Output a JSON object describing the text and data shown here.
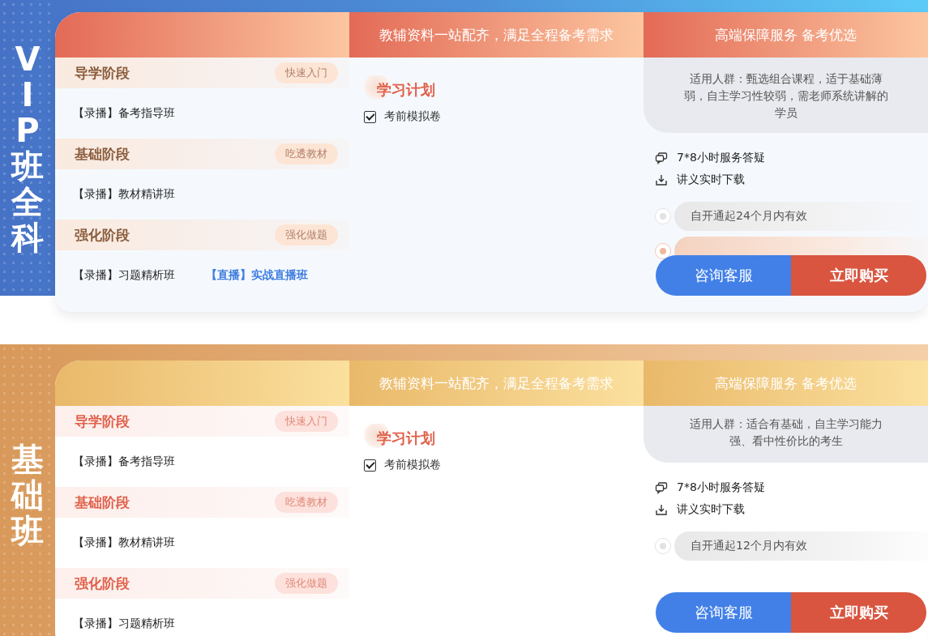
{
  "sections": [
    {
      "kind": "vip",
      "badge": "VIP班全科",
      "headers": [
        "教辅资料一站配齐，满足全程备考需求",
        "高端保障服务 备考优选"
      ],
      "stages": [
        {
          "title": "导学阶段",
          "tag": "快速入门",
          "courses": [
            {
              "label": "【录播】备考指导班",
              "kind": "recorded"
            }
          ]
        },
        {
          "title": "基础阶段",
          "tag": "吃透教材",
          "courses": [
            {
              "label": "【录播】教材精讲班",
              "kind": "recorded"
            }
          ]
        },
        {
          "title": "强化阶段",
          "tag": "强化做题",
          "courses": [
            {
              "label": "【录播】习题精析班",
              "kind": "recorded"
            },
            {
              "label": "【直播】实战直播班",
              "kind": "live"
            }
          ]
        }
      ],
      "plan": {
        "title": "学习计划",
        "items": [
          {
            "label": "考前模拟卷",
            "checked": true
          }
        ]
      },
      "audience": "适用人群：甄选组合课程，适于基础薄弱，自主学习性较弱，需老师系统讲解的学员",
      "services": [
        {
          "label": "7*8小时服务答疑",
          "kind": "chat"
        },
        {
          "label": "讲义实时下载",
          "kind": "download"
        }
      ],
      "options": [
        {
          "label": "自开通起24个月内有效",
          "selected": false
        },
        {
          "selected": true
        }
      ],
      "buttons": [
        {
          "label": "咨询客服",
          "kind": "consult"
        },
        {
          "label": "立即购买",
          "kind": "buy"
        }
      ]
    },
    {
      "kind": "basic",
      "badge": "基础班",
      "headers": [
        "教辅资料一站配齐，满足全程备考需求",
        "高端保障服务 备考优选"
      ],
      "stages": [
        {
          "title": "导学阶段",
          "tag": "快速入门",
          "courses": [
            {
              "label": "【录播】备考指导班",
              "kind": "recorded"
            }
          ]
        },
        {
          "title": "基础阶段",
          "tag": "吃透教材",
          "courses": [
            {
              "label": "【录播】教材精讲班",
              "kind": "recorded"
            }
          ]
        },
        {
          "title": "强化阶段",
          "tag": "强化做题",
          "courses": [
            {
              "label": "【录播】习题精析班",
              "kind": "recorded"
            }
          ]
        }
      ],
      "plan": {
        "title": "学习计划",
        "items": [
          {
            "label": "考前模拟卷",
            "checked": true
          }
        ]
      },
      "audience": "适用人群：适合有基础，自主学习能力强、看中性价比的考生",
      "services": [
        {
          "label": "7*8小时服务答疑",
          "kind": "chat"
        },
        {
          "label": "讲义实时下载",
          "kind": "download"
        }
      ],
      "options": [
        {
          "label": "自开通起12个月内有效",
          "selected": false
        }
      ],
      "buttons": [
        {
          "label": "咨询客服",
          "kind": "consult"
        },
        {
          "label": "立即购买",
          "kind": "buy"
        }
      ]
    }
  ]
}
